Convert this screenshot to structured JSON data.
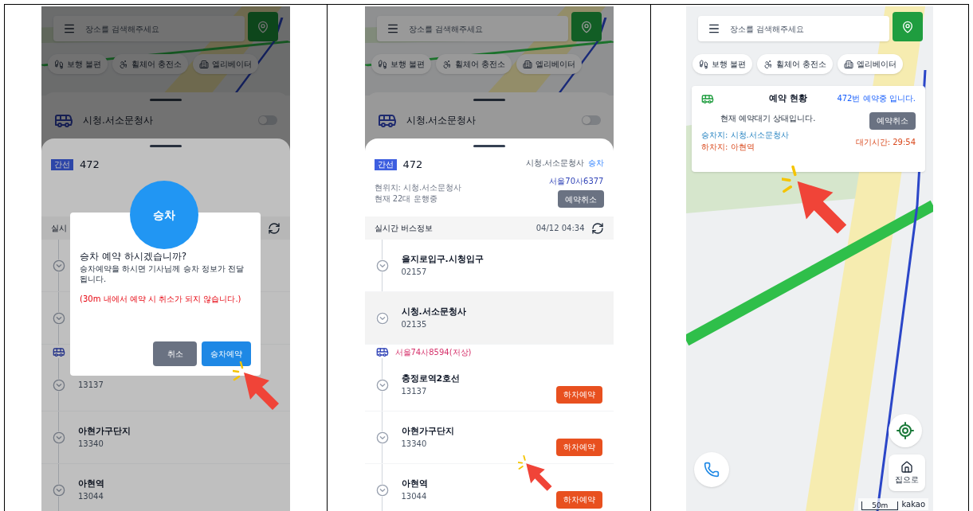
{
  "screen_left": {
    "kind": "dialog",
    "map_header": {
      "search_placeholder": "장소를 검색해주세요",
      "chips": [
        "보행 불편",
        "휠체어 충전소",
        "엘리베이터"
      ]
    },
    "stop_card": {
      "name": "시청.서소문청사",
      "alarm_on": false
    },
    "route": {
      "type": "간선",
      "number": "472"
    },
    "realtime": {
      "title": "실시"
    },
    "list": [
      {
        "kind": "stop",
        "highlighted": false
      },
      {
        "kind": "stop",
        "highlighted": false
      },
      {
        "kind": "bus"
      },
      {
        "kind": "stop",
        "code": "13137",
        "highlighted": false
      },
      {
        "kind": "stop",
        "name": "아현가구단지",
        "code": "13340",
        "highlighted": false
      },
      {
        "kind": "stop",
        "name": "아현역",
        "code": "13044",
        "highlighted": false
      }
    ],
    "dialog": {
      "badge": "승차",
      "title": "승차 예약 하시겠습니까?",
      "message": "승차예약을 하시면 기사님께 승차 정보가 전달됩니다.",
      "warning": "(30m 내에서 예약 시 취소가 되지 않습니다.)",
      "cancel": "취소",
      "confirm": "승차예약"
    }
  },
  "screen_middle": {
    "kind": "list",
    "map_header": {
      "search_placeholder": "장소를 검색해주세요",
      "chips": [
        "보행 불편",
        "휠체어 충전소",
        "엘리베이터"
      ]
    },
    "stop_card": {
      "name": "시청.서소문청사",
      "alarm_on": false
    },
    "route": {
      "type": "간선",
      "number": "472",
      "direction": "시청.서소문청사",
      "boarding": "승차",
      "info": [
        "현위치: 시청.서소문청사",
        "현재 22대 운행중"
      ],
      "plate": "서울70사6377",
      "cancel": "예약취소"
    },
    "realtime": {
      "title": "실시간 버스정보",
      "time": "04/12 04:34"
    },
    "list": [
      {
        "kind": "stop",
        "name": "을지로입구.시청입구",
        "code": "02157",
        "highlighted": false
      },
      {
        "kind": "stop",
        "name": "시청.서소문청사",
        "code": "02135",
        "highlighted": true
      },
      {
        "kind": "bus",
        "plate": "서울74사8594(저상)"
      },
      {
        "kind": "stop",
        "name": "충정로역2호선",
        "code": "13137",
        "action": "하차예약",
        "highlighted": false
      },
      {
        "kind": "stop",
        "name": "아현가구단지",
        "code": "13340",
        "action": "하차예약",
        "highlighted": false
      },
      {
        "kind": "stop",
        "name": "아현역",
        "code": "13044",
        "action": "하차예약",
        "highlighted": false
      }
    ]
  },
  "screen_right": {
    "kind": "map",
    "map_header": {
      "search_placeholder": "장소를 검색해주세요",
      "chips": [
        "보행 불편",
        "휠체어 충전소",
        "엘리베이터"
      ]
    },
    "reservation": {
      "title": "예약 현황",
      "status": "472번 예약중 입니다.",
      "message": "현재 예약대기 상태입니다.",
      "boarding": "승차지: 시청.서소문청사",
      "alighting": "하차지: 아현역",
      "cancel": "예약취소",
      "wait": "대기시간: 29:54"
    },
    "home_label": "집으로",
    "scale": "50m",
    "brand": "kakao"
  }
}
